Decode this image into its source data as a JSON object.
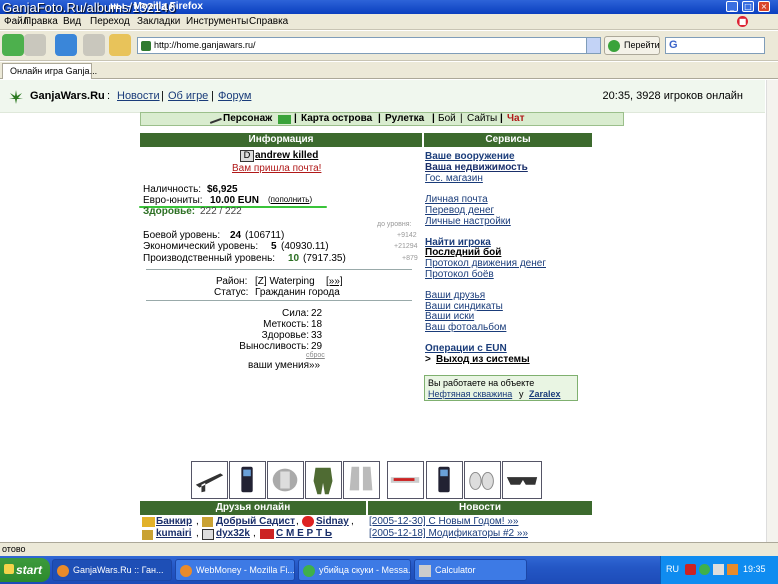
{
  "window": {
    "watermark": "GanjaFoto.Ru/albums/132146",
    "title": "ны - Mozilla Firefox"
  },
  "menubar": {
    "items": [
      "Файл",
      "Правка",
      "Вид",
      "Переход",
      "Закладки",
      "Инструменты",
      "Справка"
    ]
  },
  "toolbar": {
    "address": "http://home.ganjawars.ru/",
    "go_label": "Перейти",
    "search_prefix": "G"
  },
  "tabs": [
    {
      "label": "Онлайн игра Ganja..."
    }
  ],
  "header": {
    "site": "GanjaWars.Ru",
    "sep": ":",
    "links": [
      "Новости",
      "Об игре",
      "Форум"
    ],
    "status": "20:35, 3928 игроков онлайн"
  },
  "nav": {
    "items": [
      "Персонаж",
      "Карта острова",
      "Рулетка",
      "Бой",
      "Сайты",
      "Чат"
    ]
  },
  "info": {
    "heading": "Информация",
    "player_name": "andrew killed",
    "mail_notice": "Вам пришла почта!",
    "cash_label": "Наличность:",
    "cash_value": "$6,925",
    "euro_label": "Евро-юниты:",
    "euro_value": "10.00 EUN",
    "euro_topup": "пополнить",
    "health_label": "Здоровье:",
    "health_value": "222 / 222",
    "to_level": "до уровня:",
    "combat_label": "Боевой уровень:",
    "combat_level": "24",
    "combat_exp": "(106711)",
    "combat_next": "+9142",
    "econ_label": "Экономический уровень:",
    "econ_level": "5",
    "econ_exp": "(40930.11)",
    "econ_next": "+21294",
    "prod_label": "Производственный уровень:",
    "prod_level": "10",
    "prod_exp": "(7917.35)",
    "prod_next": "+879",
    "district_label": "Район:",
    "district_value": "[Z] Waterping",
    "district_more": "[»»]",
    "status_label": "Статус:",
    "status_value": "Гражданин города",
    "skills": [
      {
        "name": "Сила:",
        "value": "22"
      },
      {
        "name": "Меткость:",
        "value": "18"
      },
      {
        "name": "Здоровье:",
        "value": "33"
      },
      {
        "name": "Выносливость:",
        "value": "29"
      }
    ],
    "reset": "сброс",
    "skills_link": "ваши умения»»"
  },
  "services": {
    "heading": "Сервисы",
    "group1": [
      "Ваше вооружение",
      "Ваша недвижимость",
      "Гос. магазин"
    ],
    "group2": [
      "Личная почта",
      "Перевод денег",
      "Личные настройки"
    ],
    "group3": [
      "Найти игрока",
      "Последний бой",
      "Протокол движения денег",
      "Протокол боёв"
    ],
    "group4": [
      "Ваши друзья",
      "Ваши синдикаты",
      "Ваши иски",
      "Ваш фотоальбом"
    ],
    "eun_ops": "Операции с EUN",
    "logout_prefix": ">",
    "logout": "Выход из системы",
    "object_line": "Вы работаете на объекте",
    "object_name": "Нефтяная скважина",
    "object_owner_prefix": "у",
    "object_owner": "Zaralex"
  },
  "friends": {
    "heading": "Друзья онлайн",
    "row1": [
      "Банкир",
      "Добрый Садист",
      "Sidnay"
    ],
    "row2": [
      "kumairi",
      "dyx32k",
      "С М Е Р Т Ь"
    ]
  },
  "news": {
    "heading": "Новости",
    "items": [
      "[2005-12-30] С Новым Годом! »»",
      "[2005-12-18] Модификаторы #2 »»"
    ]
  },
  "equipment_icons": [
    "rifle-icon",
    "phone-icon",
    "armor-icon",
    "camo-suit-icon",
    "boots-icon",
    "grenade-launcher-icon",
    "phone-icon",
    "shoes-icon",
    "glasses-icon"
  ],
  "statusbar": {
    "text": "отово"
  },
  "taskbar": {
    "start": "start",
    "tasks": [
      "GanjaWars.Ru :: Ган...",
      "WebMoney - Mozilla Fi...",
      "убийца скуки - Messa...",
      "Calculator"
    ],
    "lang": "RU",
    "time": "19:35"
  }
}
